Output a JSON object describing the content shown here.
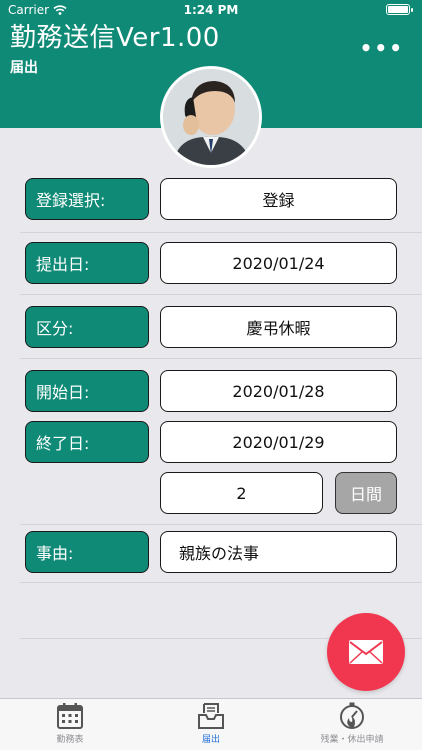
{
  "status_bar": {
    "carrier": "Carrier",
    "time": "1:24 PM"
  },
  "header": {
    "title": "勤務送信Ver1.00",
    "subtitle": "届出",
    "more_label": "•••"
  },
  "form": {
    "registration": {
      "label": "登録選択:",
      "value": "登録"
    },
    "submit_date": {
      "label": "提出日:",
      "value": "2020/01/24"
    },
    "category": {
      "label": "区分:",
      "value": "慶弔休暇"
    },
    "start_date": {
      "label": "開始日:",
      "value": "2020/01/28"
    },
    "end_date": {
      "label": "終了日:",
      "value": "2020/01/29"
    },
    "days": {
      "value": "2",
      "unit": "日間"
    },
    "reason": {
      "label": "事由:",
      "value": "親族の法事"
    }
  },
  "tabs": [
    {
      "label": "勤務表",
      "icon": "calendar-icon",
      "active": false
    },
    {
      "label": "届出",
      "icon": "inbox-tray-icon",
      "active": true
    },
    {
      "label": "残業・休出申請",
      "icon": "stopwatch-icon",
      "active": false
    }
  ],
  "colors": {
    "primary": "#0f8a76",
    "accent": "#f0374f",
    "active_tab": "#1f6fd6",
    "background": "#e9e9ed"
  }
}
